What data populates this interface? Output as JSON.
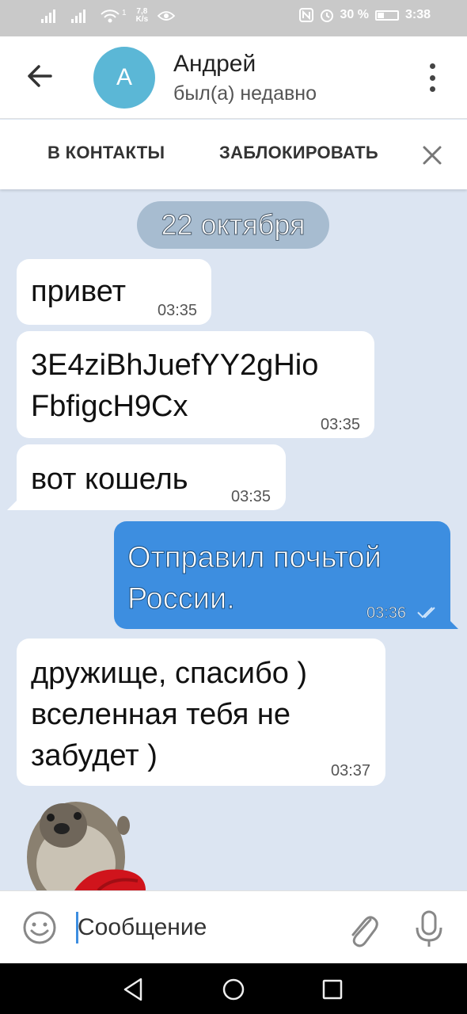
{
  "status_bar": {
    "net_speed": "7,8",
    "net_unit": "K/s",
    "sim_badge": "1",
    "battery": "30 %",
    "time": "3:38"
  },
  "header": {
    "avatar_letter": "А",
    "contact_name": "Андрей",
    "last_seen": "был(а) недавно"
  },
  "actions": {
    "add_contact": "В КОНТАКТЫ",
    "block": "ЗАБЛОКИРОВАТЬ"
  },
  "date_divider": "22 октября",
  "messages": [
    {
      "direction": "in",
      "text": "привет",
      "time": "03:35"
    },
    {
      "direction": "in",
      "text_line1": "3E4ziBhJuefYY2gHio",
      "text_line2": "FbfigcH9Cx",
      "time": "03:35"
    },
    {
      "direction": "in",
      "text": "вот кошель",
      "time": "03:35"
    },
    {
      "direction": "out",
      "text_line1": "Отправил почьтой",
      "text_line2": "России.",
      "time": "03:36",
      "read": true
    },
    {
      "direction": "in",
      "text_line1": "дружище, спасибо )",
      "text_line2": "вселенная тебя не",
      "text_line3": "забудет )",
      "time": "03:37"
    }
  ],
  "composer": {
    "placeholder": "Сообщение"
  },
  "colors": {
    "chat_background": "#dce5f2",
    "outgoing_bubble": "#3d8ee0",
    "avatar": "#5bb7d6",
    "date_pill": "#a7bcd0"
  }
}
